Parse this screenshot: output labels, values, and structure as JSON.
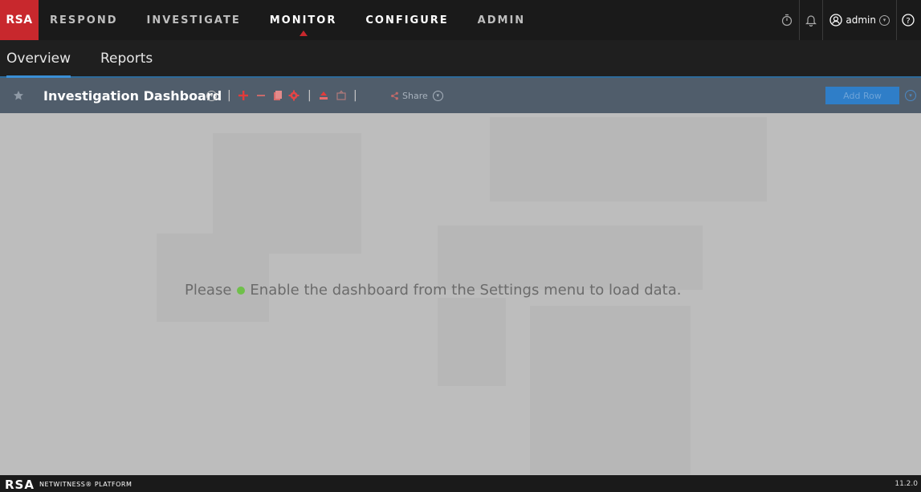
{
  "top_nav": {
    "logo": "RSA",
    "items": [
      "RESPOND",
      "INVESTIGATE",
      "MONITOR",
      "CONFIGURE",
      "ADMIN"
    ],
    "active": "MONITOR",
    "user": "admin",
    "icons": [
      "stopwatch-icon",
      "bell-icon",
      "user-icon",
      "help-icon"
    ]
  },
  "sub_nav": {
    "tabs": [
      "Overview",
      "Reports"
    ],
    "active": "Overview"
  },
  "toolbar": {
    "dashboard_title": "Investigation Dashboard",
    "separator": "|",
    "share_label": "Share",
    "add_row_label": "Add Row",
    "icons": [
      "add-dashlet-icon",
      "remove-icon",
      "copy-icon",
      "settings-gear-icon",
      "import-icon",
      "export-icon",
      "share-icon"
    ]
  },
  "main": {
    "message_prefix": "Please",
    "message_text": "Enable the dashboard from the Settings menu to load data."
  },
  "footer": {
    "logo": "RSA",
    "product": "NETWITNESS® PLATFORM",
    "version": "11.2.0"
  },
  "colors": {
    "brand_red": "#c8282d",
    "accent_blue": "#3a8fd6",
    "status_green": "#6fc04a",
    "toolbar_bg": "#505d6b"
  }
}
